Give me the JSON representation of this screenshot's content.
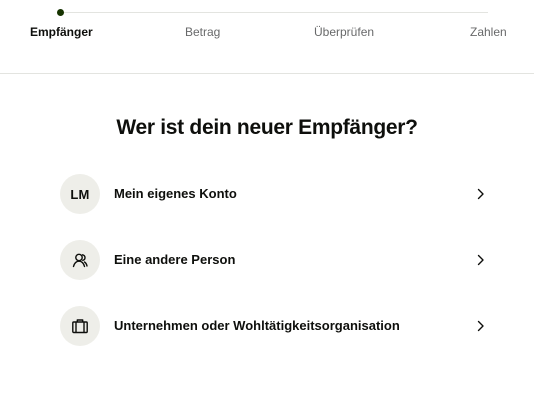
{
  "stepper": {
    "steps": [
      {
        "label": "Empfänger",
        "active": true
      },
      {
        "label": "Betrag",
        "active": false
      },
      {
        "label": "Überprüfen",
        "active": false
      },
      {
        "label": "Zahlen",
        "active": false
      }
    ]
  },
  "main": {
    "title": "Wer ist dein neuer Empfänger?",
    "options": [
      {
        "avatar_text": "LM",
        "label": "Mein eigenes Konto",
        "icon": "chevron-right-icon"
      },
      {
        "avatar_icon": "person-icon",
        "label": "Eine andere Person",
        "icon": "chevron-right-icon"
      },
      {
        "avatar_icon": "briefcase-icon",
        "label": "Unternehmen oder Wohltätigkeitsorganisation",
        "icon": "chevron-right-icon"
      }
    ]
  },
  "colors": {
    "accent_dot": "#163300",
    "avatar_bg": "#eeeee9",
    "text": "#0e0f0c",
    "muted_text": "#68696a"
  }
}
